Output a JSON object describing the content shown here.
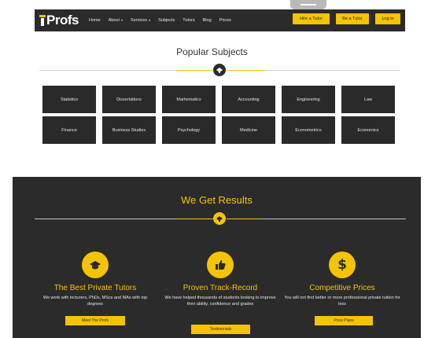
{
  "header": {
    "logo_text": "Profs",
    "nav_items": [
      {
        "label": "Home",
        "has_dropdown": false
      },
      {
        "label": "About",
        "has_dropdown": true
      },
      {
        "label": "Services",
        "has_dropdown": true
      },
      {
        "label": "Subjects",
        "has_dropdown": false
      },
      {
        "label": "Tutors",
        "has_dropdown": false
      },
      {
        "label": "Blog",
        "has_dropdown": false
      },
      {
        "label": "Prices",
        "has_dropdown": false
      }
    ],
    "dropdown_caret": "▾",
    "hire_tutor_label": "Hire a Tutor",
    "be_tutor_label": "Be a Tutor",
    "login_label": "Log in"
  },
  "popular_subjects": {
    "title": "Popular Subjects",
    "subjects": [
      "Statistics",
      "Dissertations",
      "Mathematics",
      "Accounting",
      "Engineering",
      "Law",
      "Finance",
      "Business Studies",
      "Psychology",
      "Medicine",
      "Econometrics",
      "Economics"
    ]
  },
  "results": {
    "title": "We Get Results",
    "features": [
      {
        "icon": "graduation-cap-icon",
        "title": "The Best Private Tutors",
        "description": "We work with lecturers, PhDs, MScs and MAs with top degrees",
        "button": "Meet The Profs"
      },
      {
        "icon": "thumbs-up-icon",
        "title": "Proven Track-Record",
        "description": "We have helped thousands of students looking to improve their ability, confidence and grades",
        "button": "Testimonials"
      },
      {
        "icon": "dollar-icon",
        "title": "Competitive Prices",
        "description": "You will not find better or more professional private tuition for less",
        "button": "Price Plans"
      }
    ]
  },
  "colors": {
    "accent": "#f5c400",
    "dark": "#2b2b2b",
    "tile": "#2a2a2a"
  }
}
